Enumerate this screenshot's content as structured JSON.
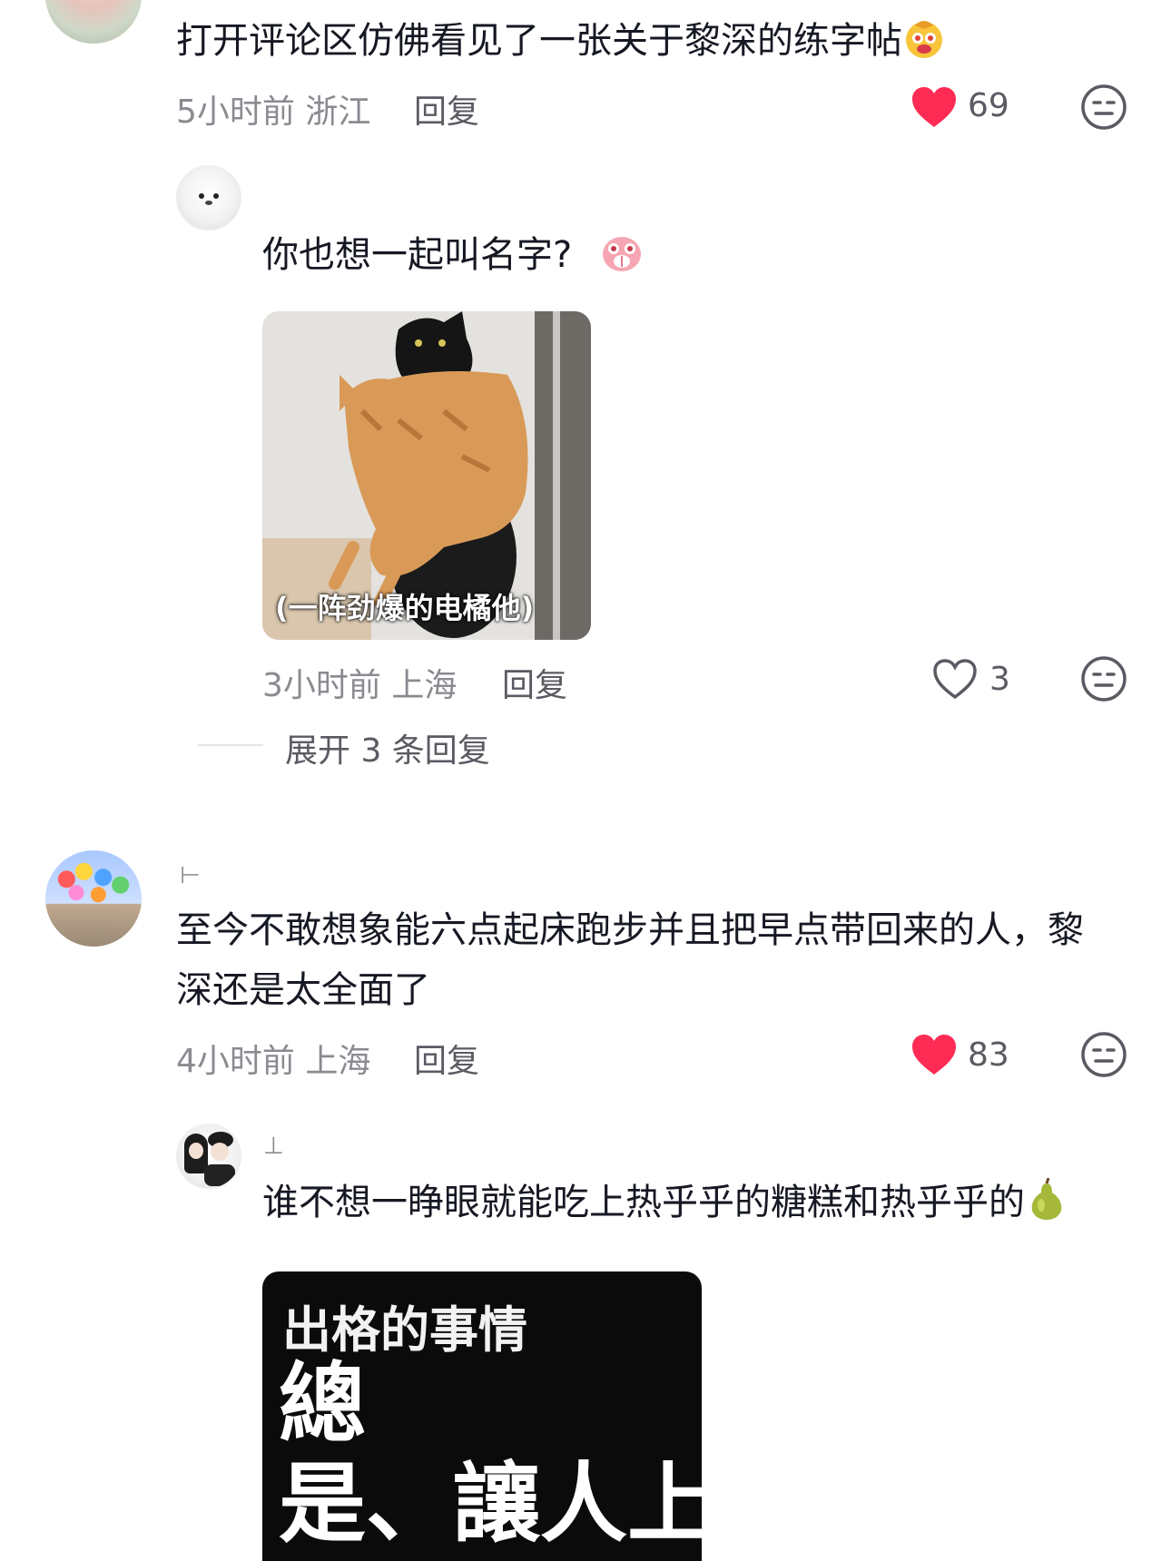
{
  "comments": [
    {
      "avatar": "portrait-avatar",
      "text": "打开评论区仿佛看见了一张关于黎深的练字帖",
      "emoji": "clown-emoji",
      "time": "5小时前",
      "location": "浙江",
      "reply_label": "回复",
      "liked": true,
      "likes": "69"
    },
    {
      "avatar": "seal-avatar",
      "text": "你也想一起叫名字?",
      "emoji": "shy-pig-emoji",
      "image_caption": "(一阵劲爆的电橘他)",
      "time": "3小时前",
      "location": "上海",
      "reply_label": "回复",
      "liked": false,
      "likes": "3",
      "expand_label": "展开 3 条回复"
    },
    {
      "avatar": "balloons-avatar",
      "text_line1": "至今不敢想象能六点起床跑步并且把早点带回来的人，黎",
      "text_line2": "深还是太全面了",
      "time": "4小时前",
      "location": "上海",
      "reply_label": "回复",
      "liked": true,
      "likes": "83"
    },
    {
      "avatar": "couple-avatar",
      "text": "谁不想一睁眼就能吃上热乎乎的糖糕和热乎乎的",
      "emoji": "pear-emoji",
      "poster_title": "出格的事情",
      "poster_line1": "總",
      "poster_line2": "是、讓人上癮"
    }
  ],
  "colors": {
    "like_red": "#fe2c55",
    "text": "#161823",
    "meta_gray": "#8a8b91"
  }
}
